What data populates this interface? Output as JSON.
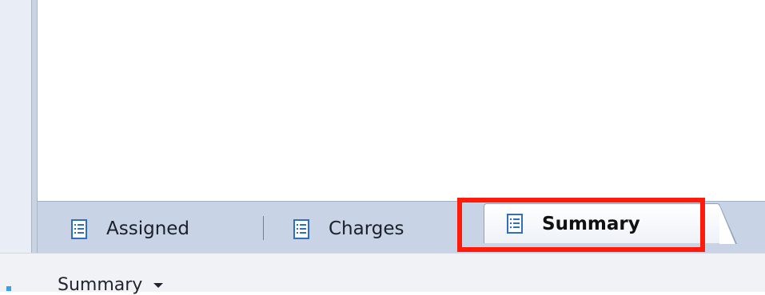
{
  "tabs": [
    {
      "label": "Assigned",
      "icon": "document-icon"
    },
    {
      "label": "Charges",
      "icon": "document-icon"
    },
    {
      "label": "Summary",
      "icon": "document-icon",
      "active": true
    }
  ],
  "bottom_bar": {
    "dropdown_label": "Summary"
  },
  "colors": {
    "highlight": "#ff1a0a",
    "tab_strip": "#c8d4e5",
    "icon_blue": "#2f6fc0"
  }
}
